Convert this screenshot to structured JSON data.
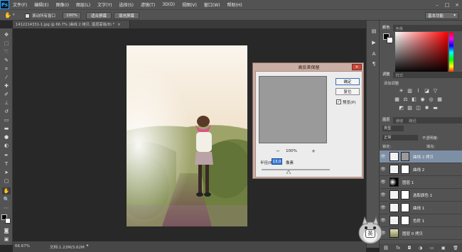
{
  "menubar": {
    "logo": "Ps",
    "items": [
      "文件(F)",
      "编辑(E)",
      "图像(I)",
      "图层(L)",
      "文字(Y)",
      "选择(S)",
      "滤镜(T)",
      "3D(D)",
      "视图(V)",
      "窗口(W)",
      "帮助(H)"
    ],
    "window_controls": [
      "–",
      "□",
      "×"
    ]
  },
  "options_bar": {
    "scroll_all_windows": "滚动所有窗口",
    "zoom_100": "100%",
    "fit_screen": "适合屏幕",
    "fill_screen": "填充屏幕",
    "workspace": "基本功能"
  },
  "document_tab": {
    "title": "1412214331-1.jpg @ 66.7% (曲线 2 拷贝, 图层蒙版/8) *",
    "close": "×"
  },
  "status_bar": {
    "zoom": "66.67%",
    "doc_info": "文档:1.22M/3.62M"
  },
  "dialog": {
    "title": "高反差保留",
    "close": "×",
    "ok_label": "确定",
    "reset_label": "复位",
    "preview_label": "预览(P)",
    "zoom_out": "−",
    "zoom_level": "100%",
    "zoom_in": "+",
    "radius_label": "半径(R):",
    "radius_value": "13.0",
    "radius_unit": "像素"
  },
  "panels": {
    "color_tabs": [
      "颜色",
      "色板"
    ],
    "adjust_tabs": [
      "调整",
      "样式"
    ],
    "add_adjustment": "添加调整",
    "layers_tabs": [
      "图层",
      "通道",
      "路径"
    ],
    "filter_kind": "类型",
    "blend_mode": "正常",
    "opacity_label": "不透明度:",
    "lock_label": "锁定:",
    "fill_label": "填充:",
    "layers": [
      {
        "name": "曲线 2 拷贝",
        "selected": true
      },
      {
        "name": "曲线 2",
        "selected": false
      },
      {
        "name": "图层 1",
        "selected": false
      },
      {
        "name": "选取颜色 1",
        "selected": false
      },
      {
        "name": "曲线 1",
        "selected": false
      },
      {
        "name": "色阶 1",
        "selected": false
      },
      {
        "name": "图层 0 拷贝",
        "selected": false
      }
    ]
  },
  "watermark": {
    "ime_label": "英"
  },
  "colors": {
    "app_bg": "#282828",
    "panel": "#535353",
    "dialog_frame": "#cbaea3",
    "selected_layer": "#7d8fa5"
  }
}
